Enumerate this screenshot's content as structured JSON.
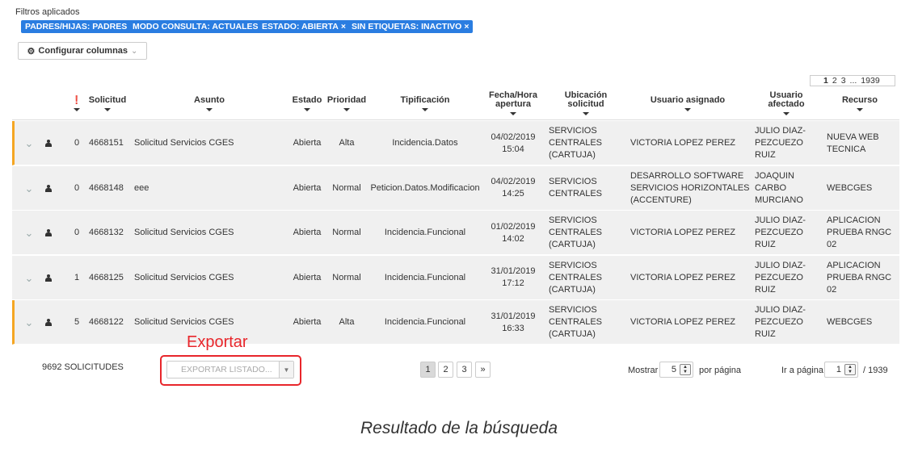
{
  "filters": {
    "label": "Filtros aplicados",
    "chips": [
      {
        "text": "PADRES/HIJAS: PADRES",
        "removable": false
      },
      {
        "text": "MODO CONSULTA: ACTUALES",
        "removable": false
      },
      {
        "text": "ESTADO: ABIERTA",
        "removable": true
      },
      {
        "text": "SIN ETIQUETAS: INACTIVO",
        "removable": true
      }
    ],
    "remove_glyph": "×",
    "chip_color": "#2a7de1"
  },
  "toolbar": {
    "configure_columns": "Configurar columnas"
  },
  "top_pagination": {
    "current": "1",
    "pages": [
      "2",
      "3"
    ],
    "ellipsis": "...",
    "last": "1939"
  },
  "table": {
    "headers": {
      "priority_flag": "❗",
      "solicitud": "Solicitud",
      "asunto": "Asunto",
      "estado": "Estado",
      "prioridad": "Prioridad",
      "tipificacion": "Tipificación",
      "fecha_line1": "Fecha/Hora",
      "fecha_line2": "apertura",
      "ubicacion": "Ubicación solicitud",
      "usuario_asignado": "Usuario asignado",
      "usuario_afectado_line1": "Usuario",
      "usuario_afectado_line2": "afectado",
      "recurso": "Recurso"
    },
    "rows": [
      {
        "flagged": true,
        "count": "0",
        "solicitud": "4668151",
        "asunto": "Solicitud Servicios CGES",
        "estado": "Abierta",
        "prioridad": "Alta",
        "tipificacion": "Incidencia.Datos",
        "fecha": "04/02/2019",
        "hora": "15:04",
        "ubicacion": [
          "SERVICIOS",
          "CENTRALES",
          "(CARTUJA)"
        ],
        "asignado": [
          "VICTORIA LOPEZ PEREZ"
        ],
        "afectado": [
          "JULIO DIAZ-",
          "PEZCUEZO",
          "RUIZ"
        ],
        "recurso": [
          "NUEVA WEB",
          "TECNICA"
        ]
      },
      {
        "flagged": false,
        "count": "0",
        "solicitud": "4668148",
        "asunto": "eee",
        "estado": "Abierta",
        "prioridad": "Normal",
        "tipificacion": "Peticion.Datos.Modificacion",
        "fecha": "04/02/2019",
        "hora": "14:25",
        "ubicacion": [
          "SERVICIOS",
          "CENTRALES"
        ],
        "asignado": [
          "DESARROLLO SOFTWARE",
          "SERVICIOS HORIZONTALES",
          "(ACCENTURE)"
        ],
        "afectado": [
          "JOAQUIN",
          "CARBO",
          "MURCIANO"
        ],
        "recurso": [
          "WEBCGES"
        ]
      },
      {
        "flagged": false,
        "count": "0",
        "solicitud": "4668132",
        "asunto": "Solicitud Servicios CGES",
        "estado": "Abierta",
        "prioridad": "Normal",
        "tipificacion": "Incidencia.Funcional",
        "fecha": "01/02/2019",
        "hora": "14:02",
        "ubicacion": [
          "SERVICIOS",
          "CENTRALES",
          "(CARTUJA)"
        ],
        "asignado": [
          "VICTORIA LOPEZ PEREZ"
        ],
        "afectado": [
          "JULIO DIAZ-",
          "PEZCUEZO",
          "RUIZ"
        ],
        "recurso": [
          "APLICACION",
          "PRUEBA RNGC",
          "02"
        ]
      },
      {
        "flagged": false,
        "count": "1",
        "solicitud": "4668125",
        "asunto": "Solicitud Servicios CGES",
        "estado": "Abierta",
        "prioridad": "Normal",
        "tipificacion": "Incidencia.Funcional",
        "fecha": "31/01/2019",
        "hora": "17:12",
        "ubicacion": [
          "SERVICIOS",
          "CENTRALES",
          "(CARTUJA)"
        ],
        "asignado": [
          "VICTORIA LOPEZ PEREZ"
        ],
        "afectado": [
          "JULIO DIAZ-",
          "PEZCUEZO",
          "RUIZ"
        ],
        "recurso": [
          "APLICACION",
          "PRUEBA RNGC",
          "02"
        ]
      },
      {
        "flagged": true,
        "count": "5",
        "solicitud": "4668122",
        "asunto": "Solicitud Servicios CGES",
        "estado": "Abierta",
        "prioridad": "Alta",
        "tipificacion": "Incidencia.Funcional",
        "fecha": "31/01/2019",
        "hora": "16:33",
        "ubicacion": [
          "SERVICIOS",
          "CENTRALES",
          "(CARTUJA)"
        ],
        "asignado": [
          "VICTORIA LOPEZ PEREZ"
        ],
        "afectado": [
          "JULIO DIAZ-",
          "PEZCUEZO",
          "RUIZ"
        ],
        "recurso": [
          "WEBCGES"
        ]
      }
    ],
    "row_background": "#f0f0f0",
    "flag_color": "#f5a623"
  },
  "footer": {
    "total": "9692 SOLICITUDES",
    "export_annotation": "Exportar",
    "export_placeholder": "EXPORTAR LISTADO...",
    "pages": [
      "1",
      "2",
      "3"
    ],
    "next": "»",
    "show_label": "Mostrar",
    "per_page_value": "5",
    "per_page_label": "por página",
    "goto_label": "Ir a página",
    "goto_value": "1",
    "goto_total": "/ 1939",
    "annotation_color": "#e8262b"
  },
  "caption": "Resultado de la búsqueda"
}
